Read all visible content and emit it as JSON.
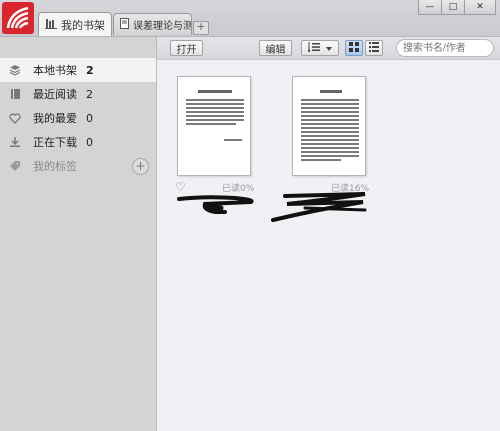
{
  "window": {
    "tabs": [
      {
        "label": "我的书架",
        "icon": "bookshelf-icon",
        "active": true
      },
      {
        "label": "误差理论与测...",
        "icon": "book-icon",
        "active": false
      }
    ],
    "new_tab_label": "+",
    "controls": {
      "minimize": "—",
      "maximize": "□",
      "close": "✕"
    }
  },
  "toolbar": {
    "open_label": "打开",
    "edit_label": "编辑",
    "search_placeholder": "搜索书名/作者"
  },
  "sidebar": {
    "items": [
      {
        "label": "本地书架",
        "count": "2",
        "icon": "layers-icon",
        "selected": true
      },
      {
        "label": "最近阅读",
        "count": "2",
        "icon": "book-icon",
        "selected": false
      },
      {
        "label": "我的最爱",
        "count": "0",
        "icon": "heart-icon",
        "selected": false
      },
      {
        "label": "正在下载",
        "count": "0",
        "icon": "download-icon",
        "selected": false
      },
      {
        "label": "我的标签",
        "count": "",
        "icon": "tag-icon",
        "selected": false
      }
    ],
    "add_tag_label": "+"
  },
  "books": [
    {
      "read_progress": "已读0%",
      "favorite": false
    },
    {
      "read_progress": "已读16%",
      "favorite": false
    }
  ],
  "colors": {
    "brand": "#d9262c",
    "sidebar_bg": "#d4d4d4",
    "content_bg": "#f0f1f5"
  }
}
